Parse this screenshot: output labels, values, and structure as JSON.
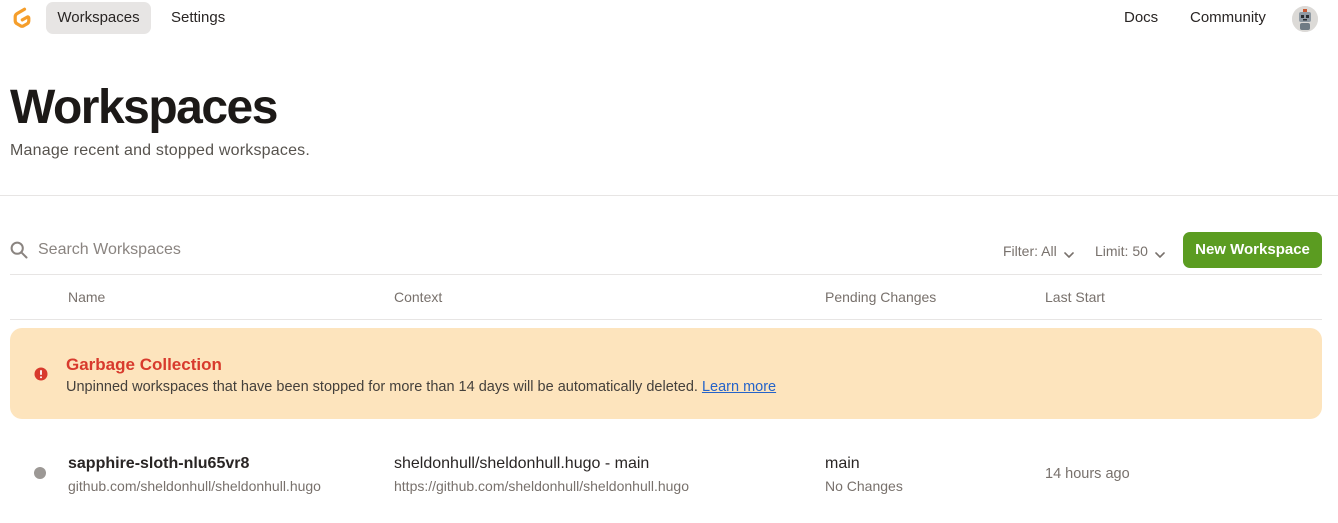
{
  "nav": {
    "workspaces_label": "Workspaces",
    "settings_label": "Settings",
    "docs_label": "Docs",
    "community_label": "Community"
  },
  "header": {
    "title": "Workspaces",
    "subtitle": "Manage recent and stopped workspaces."
  },
  "toolbar": {
    "search_placeholder": "Search Workspaces",
    "search_value": "",
    "filter_label": "Filter: All",
    "limit_label": "Limit: 50",
    "new_button_label": "New Workspace"
  },
  "table": {
    "columns": [
      "Name",
      "Context",
      "Pending Changes",
      "Last Start"
    ],
    "rows": [
      {
        "name": "sapphire-sloth-nlu65vr8",
        "repo": "github.com/sheldonhull/sheldonhull.hugo",
        "context": "sheldonhull/sheldonhull.hugo - main",
        "context_url": "https://github.com/sheldonhull/sheldonhull.hugo",
        "branch": "main",
        "changes": "No Changes",
        "last_start": "14 hours ago",
        "status": "stopped"
      }
    ]
  },
  "alert": {
    "title": "Garbage Collection",
    "text": "Unpinned workspaces that have been stopped for more than 14 days will be automatically deleted.",
    "link_label": "Learn more"
  },
  "colors": {
    "accent_green": "#5b9c21",
    "alert_bg": "#fde4bd",
    "alert_title": "#d83a2d",
    "link": "#2563c9",
    "logo_orange": "#f59e2b"
  },
  "icons": {
    "logo": "gitpod-logo",
    "search": "search-icon",
    "chevron": "chevron-down-icon",
    "alert": "exclamation-circle-icon",
    "avatar": "user-avatar"
  }
}
